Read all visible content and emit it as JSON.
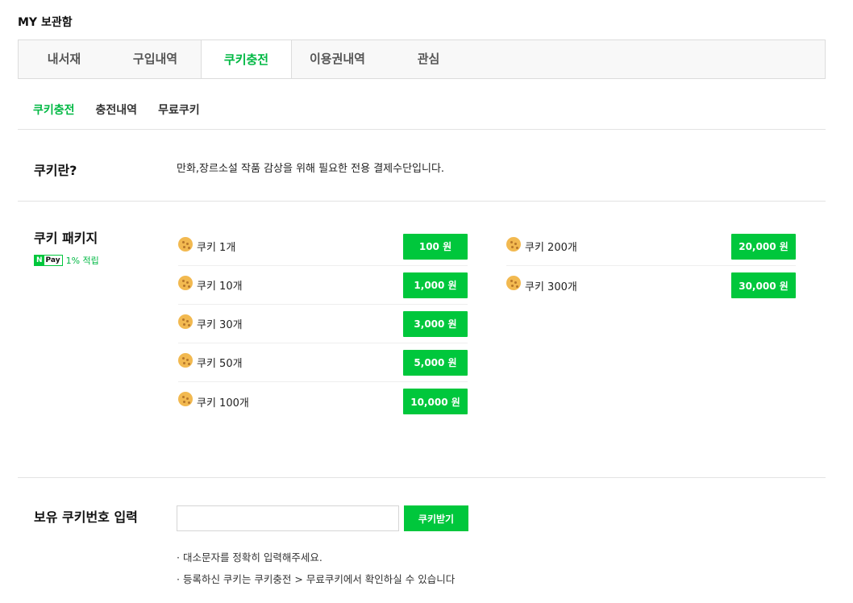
{
  "page_title": "MY 보관함",
  "main_tabs": [
    {
      "label": "내서재"
    },
    {
      "label": "구입내역"
    },
    {
      "label": "쿠키충전"
    },
    {
      "label": "이용권내역"
    },
    {
      "label": "관심"
    }
  ],
  "sub_tabs": [
    {
      "label": "쿠키충전"
    },
    {
      "label": "충전내역"
    },
    {
      "label": "무료쿠키"
    }
  ],
  "about": {
    "title": "쿠키란?",
    "description": "만화,장르소설 작품 감상을 위해 필요한 전용 결제수단입니다."
  },
  "packages": {
    "title": "쿠키 패키지",
    "npay_n": "N",
    "npay_label": "Pay",
    "npay_reward": "1% 적립",
    "left": [
      {
        "name": "쿠키 1개",
        "price": "100 원"
      },
      {
        "name": "쿠키 10개",
        "price": "1,000 원"
      },
      {
        "name": "쿠키 30개",
        "price": "3,000 원"
      },
      {
        "name": "쿠키 50개",
        "price": "5,000 원"
      },
      {
        "name": "쿠키 100개",
        "price": "10,000 원"
      }
    ],
    "right": [
      {
        "name": "쿠키 200개",
        "price": "20,000 원"
      },
      {
        "name": "쿠키 300개",
        "price": "30,000 원"
      }
    ]
  },
  "coupon": {
    "title": "보유 쿠키번호 입력",
    "input_value": "",
    "button": "쿠키받기",
    "notes": [
      "대소문자를 정확히 입력해주세요.",
      "등록하신 쿠키는 쿠키충전 > 무료쿠키에서 확인하실 수 있습니다"
    ]
  },
  "colors": {
    "accent": "#00c73c",
    "active_text": "#00b843"
  }
}
